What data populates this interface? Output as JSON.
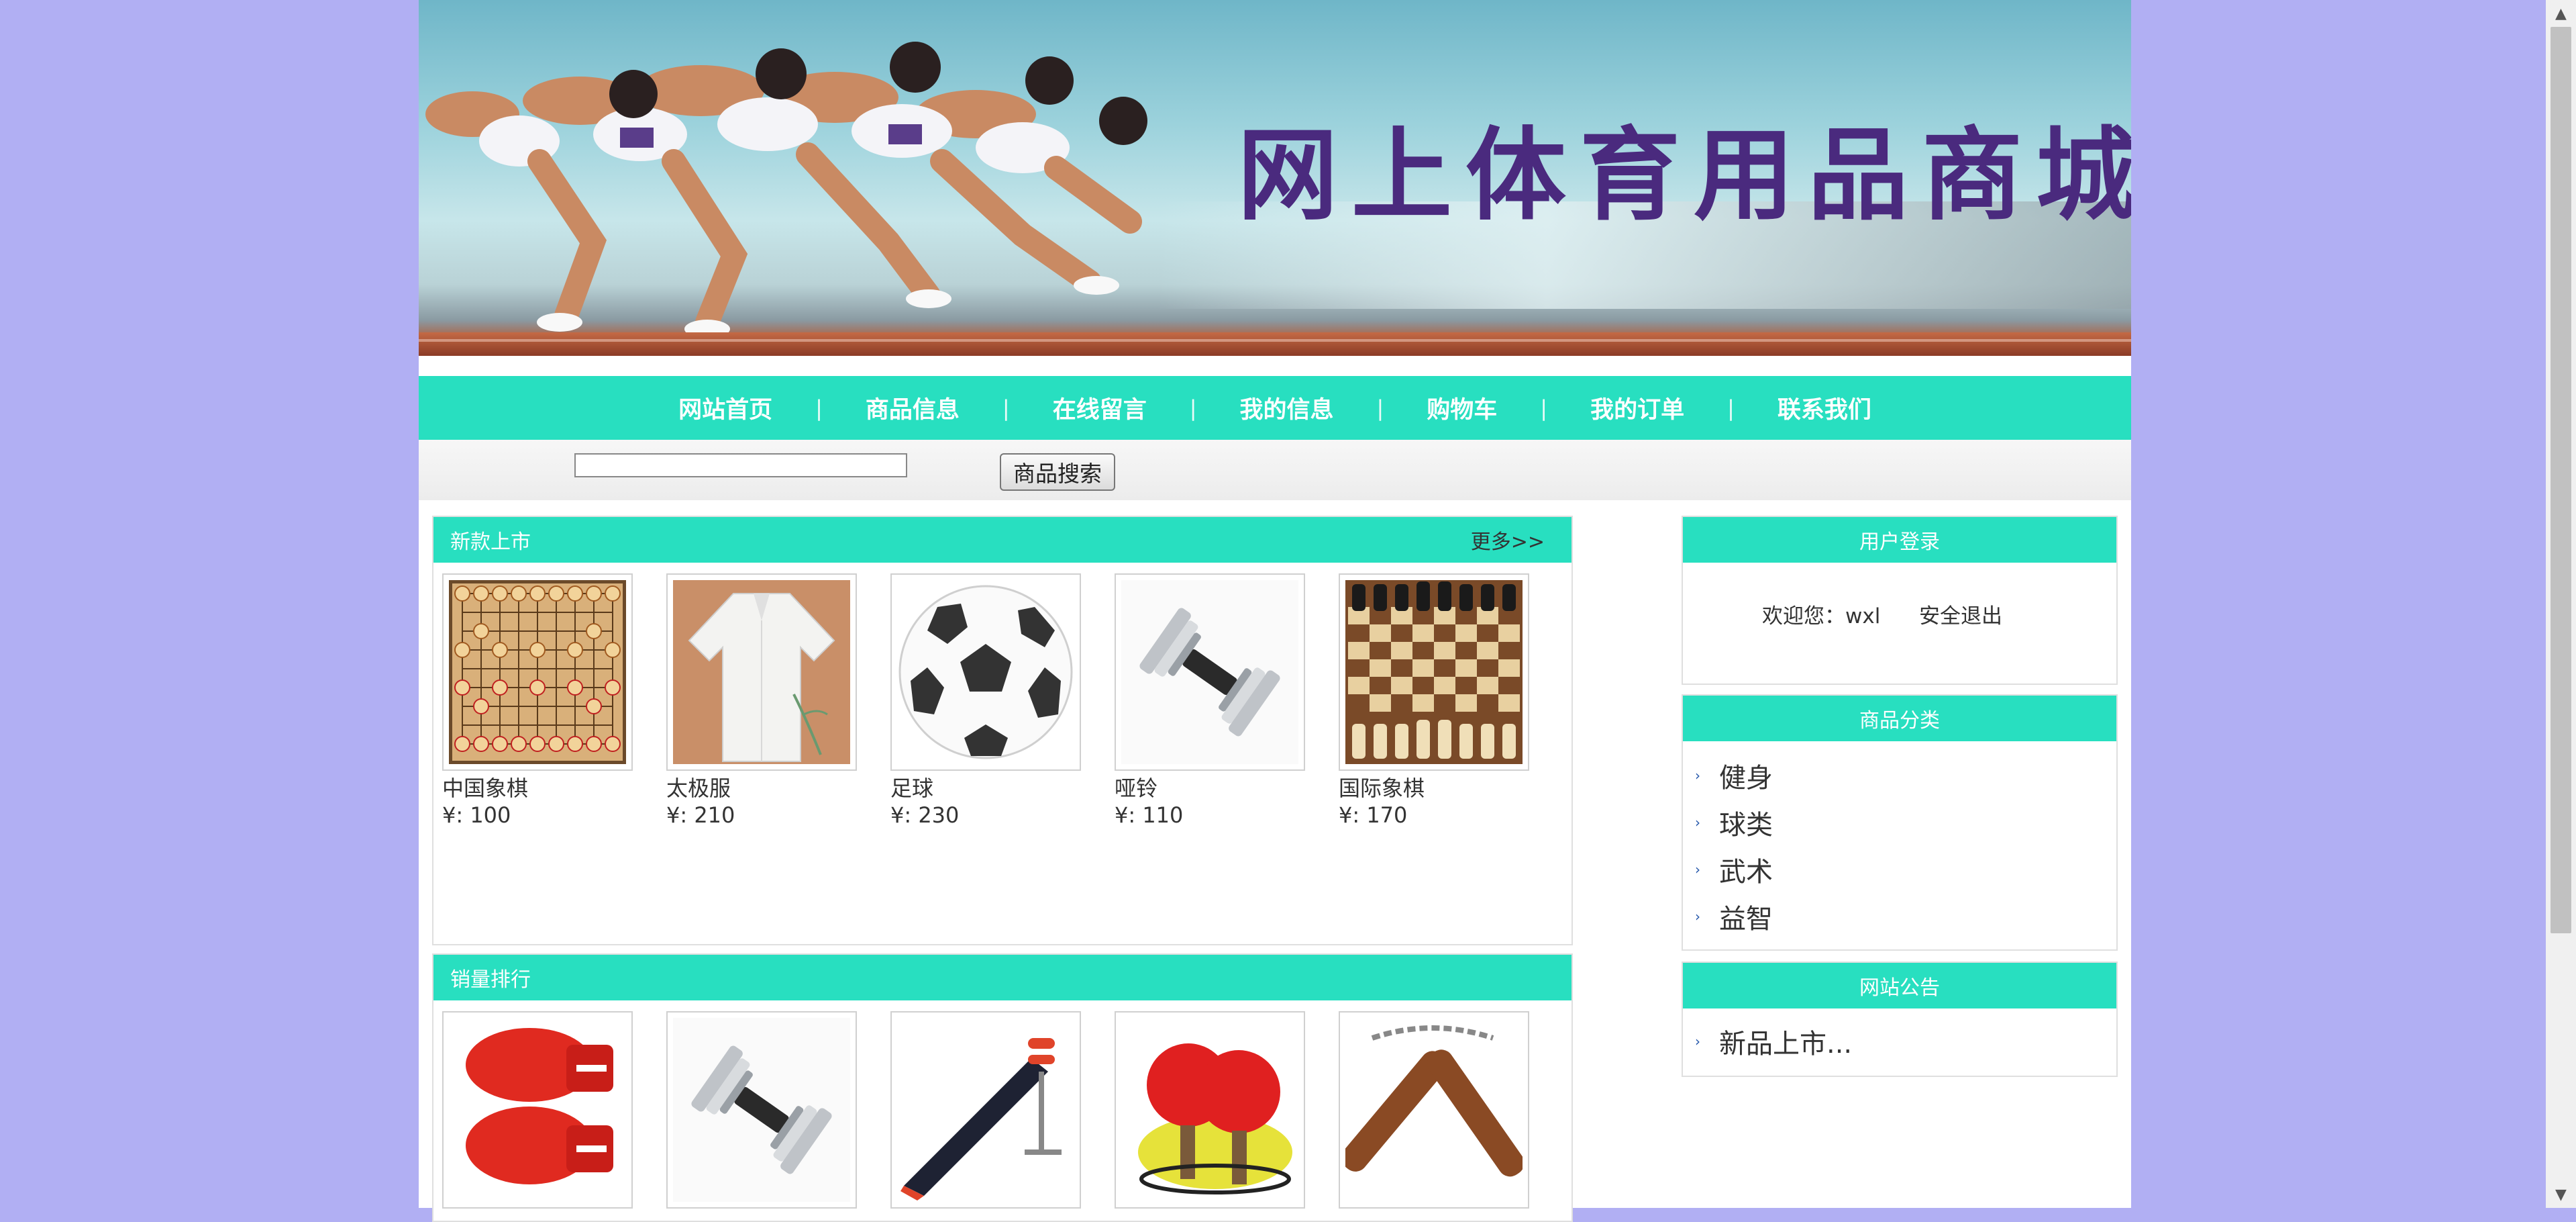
{
  "banner": {
    "title": "网上体育用品商城"
  },
  "nav": {
    "items": [
      "网站首页",
      "商品信息",
      "在线留言",
      "我的信息",
      "购物车",
      "我的订单",
      "联系我们"
    ],
    "separator": "|"
  },
  "search": {
    "value": "",
    "button_label": "商品搜索"
  },
  "new_arrivals": {
    "title": "新款上市",
    "more_label": "更多>>",
    "products": [
      {
        "name": "中国象棋",
        "price": "¥: 100",
        "image": "chinese-chess-image"
      },
      {
        "name": "太极服",
        "price": "¥: 210",
        "image": "taichi-uniform-image"
      },
      {
        "name": "足球",
        "price": "¥: 230",
        "image": "football-image"
      },
      {
        "name": "哑铃",
        "price": "¥: 110",
        "image": "dumbbell-image"
      },
      {
        "name": "国际象棋",
        "price": "¥: 170",
        "image": "chess-image"
      }
    ]
  },
  "best_sellers": {
    "title": "销量排行",
    "products": [
      {
        "image": "boxing-gloves-image"
      },
      {
        "image": "dumbbell-image"
      },
      {
        "image": "sit-up-bench-image"
      },
      {
        "image": "ping-pong-paddles-image"
      },
      {
        "image": "nunchaku-image"
      }
    ]
  },
  "login": {
    "title": "用户登录",
    "welcome": "欢迎您：wxl",
    "logout_label": "安全退出"
  },
  "categories": {
    "title": "商品分类",
    "items": [
      "健身",
      "球类",
      "武术",
      "益智"
    ]
  },
  "notice": {
    "title": "网站公告",
    "items": [
      "新品上市..."
    ]
  },
  "colors": {
    "background": "#b1aff3",
    "accent": "#28dfc0",
    "title_purple": "#4a2a7e"
  }
}
